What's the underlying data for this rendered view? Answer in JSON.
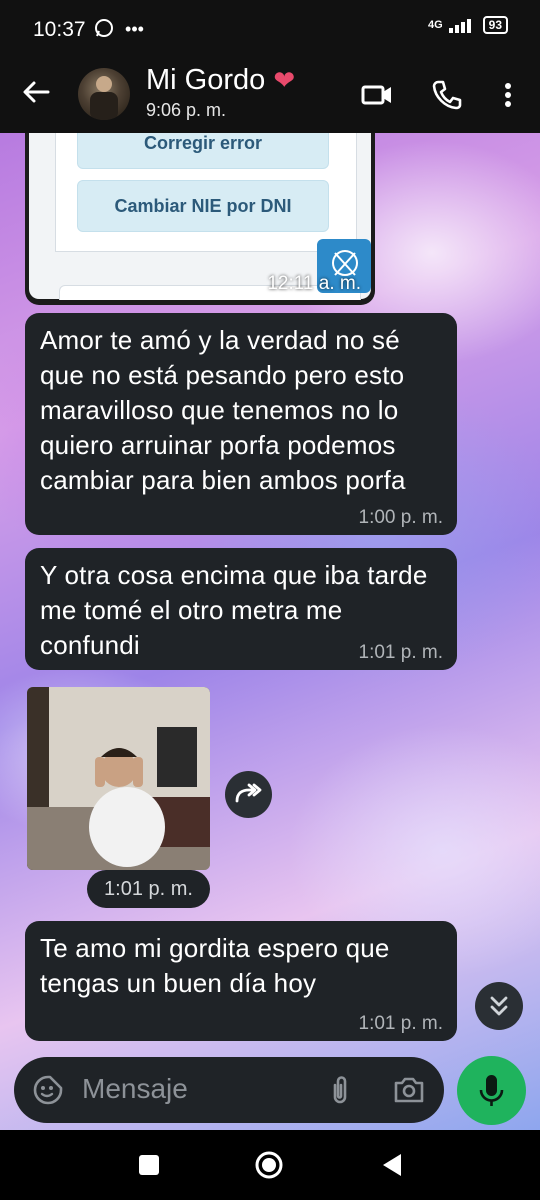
{
  "status_bar": {
    "time": "10:37",
    "network": "4G",
    "battery": "93"
  },
  "header": {
    "contact_name": "Mi Gordo",
    "contact_emoji": "❤‍🔥",
    "last_seen": "9:06 p. m."
  },
  "shared_card": {
    "buttons": [
      "Corregir error",
      "Cambiar NIE por DNI"
    ],
    "time": "12:11 a. m."
  },
  "messages": [
    {
      "text": "Amor te amó y la verdad no sé que no está pesando pero esto maravilloso que tenemos no lo quiero arruinar porfa podemos cambiar para bien ambos porfa",
      "time": "1:00 p. m."
    },
    {
      "text": "Y otra cosa encima que iba tarde me tomé el otro metra me confundi",
      "time": "1:01 p. m."
    },
    {
      "text": "Te amo mi gordita espero que tengas un buen día hoy",
      "time": "1:01 p. m."
    }
  ],
  "image_message": {
    "time": "1:01 p. m."
  },
  "input": {
    "placeholder": "Mensaje"
  },
  "colors": {
    "bubble": "#1f2327",
    "mic": "#1fb35d",
    "header": "#111111"
  },
  "icons": [
    "back-arrow-icon",
    "video-call-icon",
    "phone-icon",
    "more-options-icon",
    "sticker-icon",
    "attach-icon",
    "camera-icon",
    "mic-icon",
    "forward-icon",
    "chevron-double-down-icon",
    "nav-square-icon",
    "nav-home-icon",
    "nav-back-icon"
  ]
}
